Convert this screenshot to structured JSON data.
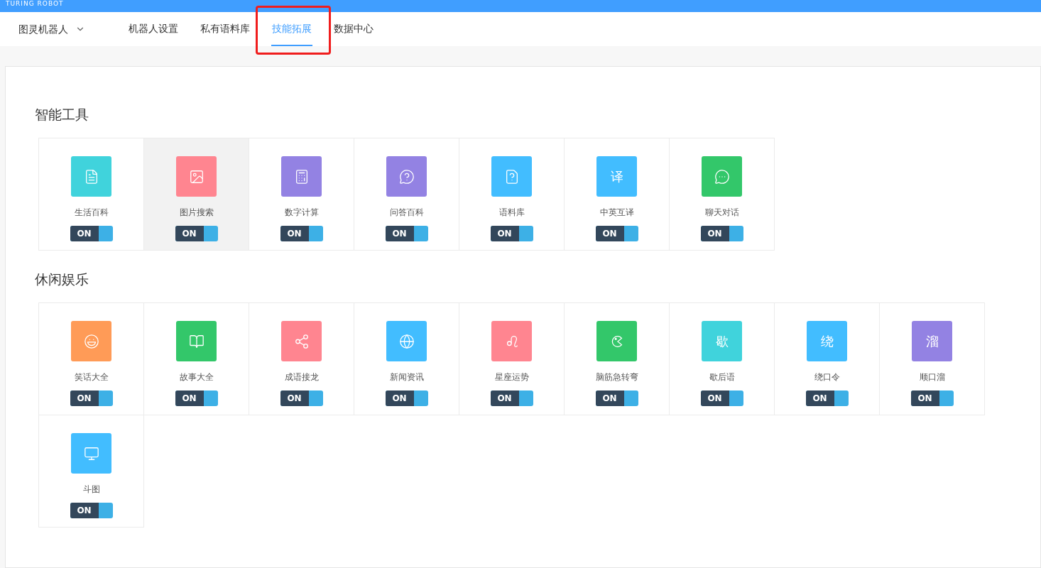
{
  "brand": "TURING ROBOT",
  "robot_selector": {
    "label": "图灵机器人"
  },
  "nav": [
    {
      "label": "机器人设置",
      "selected": false,
      "annotated": false
    },
    {
      "label": "私有语料库",
      "selected": false,
      "annotated": false
    },
    {
      "label": "技能拓展",
      "selected": true,
      "annotated": true
    },
    {
      "label": "数据中心",
      "selected": false,
      "annotated": false
    }
  ],
  "sections": [
    {
      "title": "智能工具",
      "skills": [
        {
          "name": "生活百科",
          "kind": "icon",
          "color": "#40d3dc",
          "on": true,
          "toggle_label": "ON",
          "highlighted": false
        },
        {
          "name": "图片搜索",
          "kind": "icon",
          "color": "#ff8590",
          "on": true,
          "toggle_label": "ON",
          "highlighted": true
        },
        {
          "name": "数字计算",
          "kind": "icon",
          "color": "#9382e3",
          "on": true,
          "toggle_label": "ON",
          "highlighted": false
        },
        {
          "name": "问答百科",
          "kind": "icon",
          "color": "#9382e3",
          "on": true,
          "toggle_label": "ON",
          "highlighted": false
        },
        {
          "name": "语料库",
          "kind": "icon",
          "color": "#42bdff",
          "on": true,
          "toggle_label": "ON",
          "highlighted": false
        },
        {
          "name": "中英互译",
          "kind": "glyph",
          "glyph": "译",
          "color": "#42bdff",
          "on": true,
          "toggle_label": "ON",
          "highlighted": false
        },
        {
          "name": "聊天对话",
          "kind": "icon",
          "color": "#33c76a",
          "on": true,
          "toggle_label": "ON",
          "highlighted": false
        }
      ]
    },
    {
      "title": "休闲娱乐",
      "skills": [
        {
          "name": "笑话大全",
          "kind": "icon",
          "color": "#ff9b57",
          "on": true,
          "toggle_label": "ON",
          "highlighted": false
        },
        {
          "name": "故事大全",
          "kind": "icon",
          "color": "#33c76a",
          "on": true,
          "toggle_label": "ON",
          "highlighted": false
        },
        {
          "name": "成语接龙",
          "kind": "icon",
          "color": "#ff8590",
          "on": true,
          "toggle_label": "ON",
          "highlighted": false
        },
        {
          "name": "新闻资讯",
          "kind": "icon",
          "color": "#42bdff",
          "on": true,
          "toggle_label": "ON",
          "highlighted": false
        },
        {
          "name": "星座运势",
          "kind": "icon",
          "color": "#ff8590",
          "on": true,
          "toggle_label": "ON",
          "highlighted": false
        },
        {
          "name": "脑筋急转弯",
          "kind": "icon",
          "color": "#33c76a",
          "on": true,
          "toggle_label": "ON",
          "highlighted": false
        },
        {
          "name": "歇后语",
          "kind": "glyph",
          "glyph": "歇",
          "color": "#40d3dc",
          "on": true,
          "toggle_label": "ON",
          "highlighted": false
        },
        {
          "name": "绕口令",
          "kind": "glyph",
          "glyph": "绕",
          "color": "#42bdff",
          "on": true,
          "toggle_label": "ON",
          "highlighted": false
        },
        {
          "name": "顺口溜",
          "kind": "glyph",
          "glyph": "溜",
          "color": "#9382e3",
          "on": true,
          "toggle_label": "ON",
          "highlighted": false
        },
        {
          "name": "斗图",
          "kind": "icon",
          "color": "#42bdff",
          "on": true,
          "toggle_label": "ON",
          "highlighted": false
        }
      ]
    }
  ]
}
